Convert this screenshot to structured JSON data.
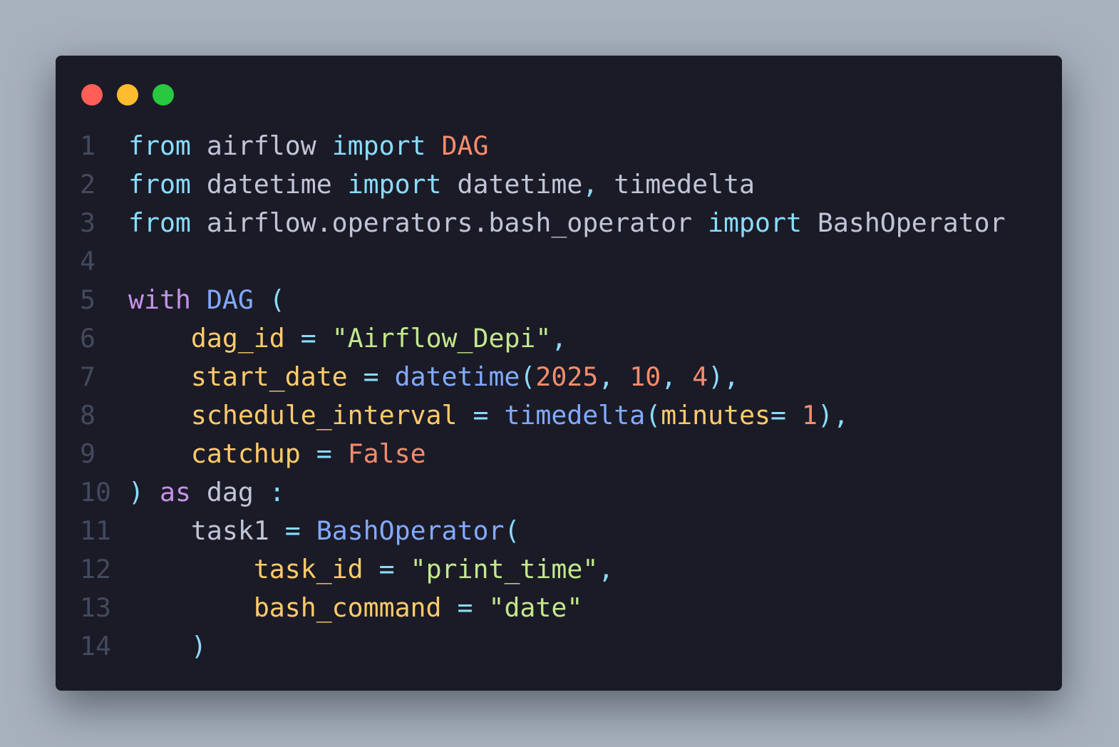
{
  "window": {
    "controls": [
      {
        "name": "close",
        "color": "#ff5f57"
      },
      {
        "name": "minimize",
        "color": "#febc2e"
      },
      {
        "name": "maximize",
        "color": "#28c840"
      }
    ]
  },
  "editor": {
    "language": "python",
    "lines": [
      {
        "number": "1",
        "tokens": [
          {
            "text": "from",
            "type": "keyword"
          },
          {
            "text": " airflow ",
            "type": "plain"
          },
          {
            "text": "import",
            "type": "keyword"
          },
          {
            "text": " ",
            "type": "plain"
          },
          {
            "text": "DAG",
            "type": "class"
          }
        ]
      },
      {
        "number": "2",
        "tokens": [
          {
            "text": "from",
            "type": "keyword"
          },
          {
            "text": " datetime ",
            "type": "plain"
          },
          {
            "text": "import",
            "type": "keyword"
          },
          {
            "text": " datetime",
            "type": "plain"
          },
          {
            "text": ",",
            "type": "punct"
          },
          {
            "text": " timedelta",
            "type": "plain"
          }
        ]
      },
      {
        "number": "3",
        "tokens": [
          {
            "text": "from",
            "type": "keyword"
          },
          {
            "text": " airflow.operators.bash_operator ",
            "type": "plain"
          },
          {
            "text": "import",
            "type": "keyword"
          },
          {
            "text": " BashOperator",
            "type": "plain"
          }
        ]
      },
      {
        "number": "4",
        "tokens": []
      },
      {
        "number": "5",
        "tokens": [
          {
            "text": "with",
            "type": "control"
          },
          {
            "text": " ",
            "type": "plain"
          },
          {
            "text": "DAG",
            "type": "func"
          },
          {
            "text": " ",
            "type": "plain"
          },
          {
            "text": "(",
            "type": "punct"
          }
        ]
      },
      {
        "number": "6",
        "tokens": [
          {
            "text": "    ",
            "type": "plain"
          },
          {
            "text": "dag_id",
            "type": "param"
          },
          {
            "text": " ",
            "type": "plain"
          },
          {
            "text": "=",
            "type": "op"
          },
          {
            "text": " ",
            "type": "plain"
          },
          {
            "text": "\"Airflow_Depi\"",
            "type": "string"
          },
          {
            "text": ",",
            "type": "punct"
          }
        ]
      },
      {
        "number": "7",
        "tokens": [
          {
            "text": "    ",
            "type": "plain"
          },
          {
            "text": "start_date",
            "type": "param"
          },
          {
            "text": " ",
            "type": "plain"
          },
          {
            "text": "=",
            "type": "op"
          },
          {
            "text": " ",
            "type": "plain"
          },
          {
            "text": "datetime",
            "type": "func"
          },
          {
            "text": "(",
            "type": "punct"
          },
          {
            "text": "2025",
            "type": "number"
          },
          {
            "text": ",",
            "type": "punct"
          },
          {
            "text": " ",
            "type": "plain"
          },
          {
            "text": "10",
            "type": "number"
          },
          {
            "text": ",",
            "type": "punct"
          },
          {
            "text": " ",
            "type": "plain"
          },
          {
            "text": "4",
            "type": "number"
          },
          {
            "text": "),",
            "type": "punct"
          }
        ]
      },
      {
        "number": "8",
        "tokens": [
          {
            "text": "    ",
            "type": "plain"
          },
          {
            "text": "schedule_interval",
            "type": "param"
          },
          {
            "text": " ",
            "type": "plain"
          },
          {
            "text": "=",
            "type": "op"
          },
          {
            "text": " ",
            "type": "plain"
          },
          {
            "text": "timedelta",
            "type": "func"
          },
          {
            "text": "(",
            "type": "punct"
          },
          {
            "text": "minutes",
            "type": "param"
          },
          {
            "text": "=",
            "type": "op"
          },
          {
            "text": " ",
            "type": "plain"
          },
          {
            "text": "1",
            "type": "number"
          },
          {
            "text": "),",
            "type": "punct"
          }
        ]
      },
      {
        "number": "9",
        "tokens": [
          {
            "text": "    ",
            "type": "plain"
          },
          {
            "text": "catchup",
            "type": "param"
          },
          {
            "text": " ",
            "type": "plain"
          },
          {
            "text": "=",
            "type": "op"
          },
          {
            "text": " ",
            "type": "plain"
          },
          {
            "text": "False",
            "type": "bool"
          }
        ]
      },
      {
        "number": "10",
        "tokens": [
          {
            "text": ")",
            "type": "punct"
          },
          {
            "text": " ",
            "type": "plain"
          },
          {
            "text": "as",
            "type": "control"
          },
          {
            "text": " dag ",
            "type": "plain"
          },
          {
            "text": ":",
            "type": "punct"
          }
        ]
      },
      {
        "number": "11",
        "tokens": [
          {
            "text": "    task1 ",
            "type": "plain"
          },
          {
            "text": "=",
            "type": "op"
          },
          {
            "text": " ",
            "type": "plain"
          },
          {
            "text": "BashOperator",
            "type": "func"
          },
          {
            "text": "(",
            "type": "punct"
          }
        ]
      },
      {
        "number": "12",
        "tokens": [
          {
            "text": "        ",
            "type": "plain"
          },
          {
            "text": "task_id",
            "type": "param"
          },
          {
            "text": " ",
            "type": "plain"
          },
          {
            "text": "=",
            "type": "op"
          },
          {
            "text": " ",
            "type": "plain"
          },
          {
            "text": "\"print_time\"",
            "type": "string"
          },
          {
            "text": ",",
            "type": "punct"
          }
        ]
      },
      {
        "number": "13",
        "tokens": [
          {
            "text": "        ",
            "type": "plain"
          },
          {
            "text": "bash_command",
            "type": "param"
          },
          {
            "text": " ",
            "type": "plain"
          },
          {
            "text": "=",
            "type": "op"
          },
          {
            "text": " ",
            "type": "plain"
          },
          {
            "text": "\"date\"",
            "type": "string"
          }
        ]
      },
      {
        "number": "14",
        "tokens": [
          {
            "text": "    ",
            "type": "plain"
          },
          {
            "text": ")",
            "type": "punct"
          }
        ]
      }
    ]
  }
}
